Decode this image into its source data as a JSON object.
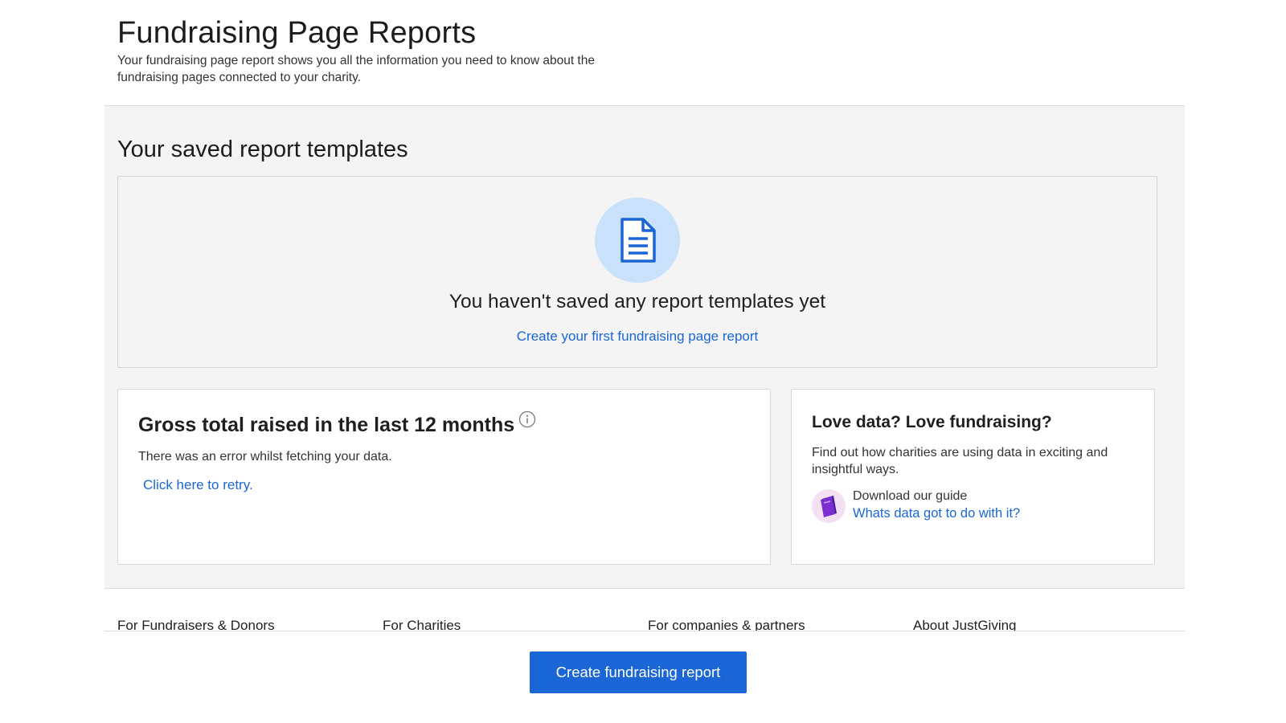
{
  "header": {
    "title": "Fundraising Page Reports",
    "subtitle": "Your fundraising page report shows you all the information you need to know about the fundraising pages connected to your charity."
  },
  "templates": {
    "section_title": "Your saved report templates",
    "icon": "document-icon",
    "empty_title": "You haven't saved any report templates yet",
    "create_link": "Create your first fundraising page report"
  },
  "gross": {
    "title": "Gross total raised in the last 12 months",
    "info_icon": "info-icon",
    "error_text": "There was an error whilst fetching your data.",
    "retry_link": "Click here to retry."
  },
  "love_data": {
    "title": "Love data? Love fundraising?",
    "text": "Find out how charities are using data in exciting and insightful ways.",
    "guide_icon": "book-icon",
    "guide_label": "Download our guide",
    "guide_link": "Whats data got to do with it?"
  },
  "footer": {
    "columns": [
      "For Fundraisers & Donors",
      "For Charities",
      "For companies & partners",
      "About JustGiving"
    ]
  },
  "cta": {
    "label": "Create fundraising report"
  },
  "colors": {
    "accent": "#1a66d6",
    "panel_bg": "#f4f4f4",
    "icon_circle": "#c9e1fb",
    "guide_purple": "#7b2fd0"
  }
}
